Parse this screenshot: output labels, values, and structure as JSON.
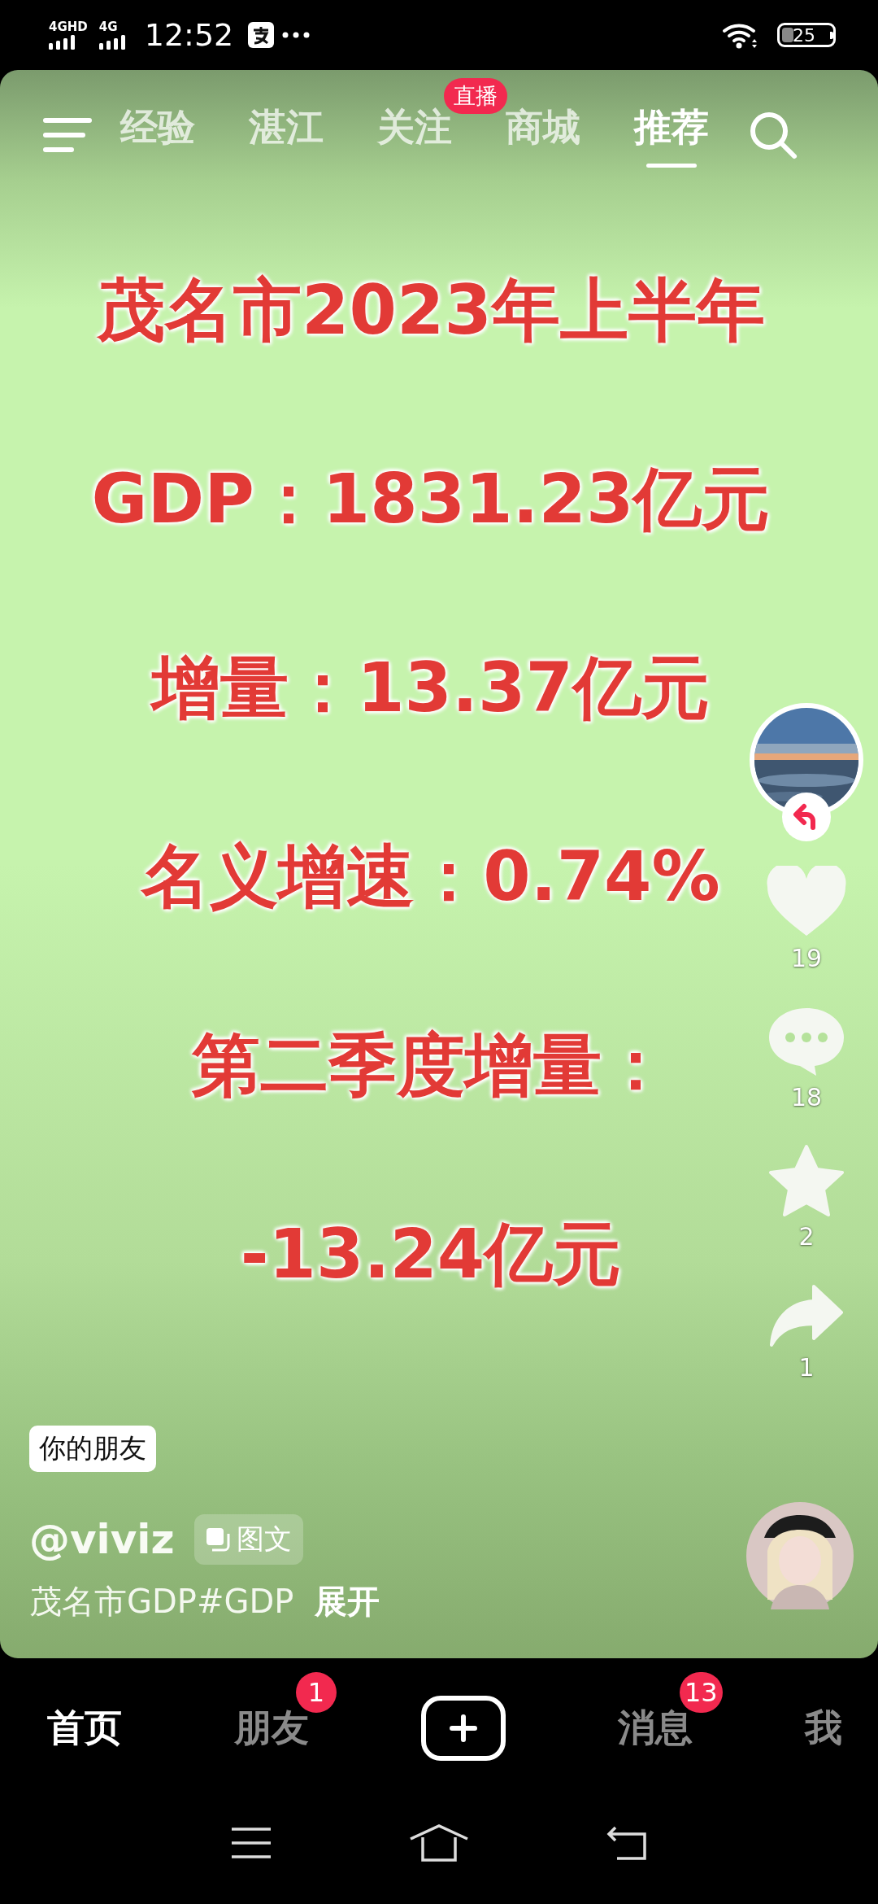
{
  "status_bar": {
    "networks": [
      "4GHD",
      "4G"
    ],
    "time": "12:52",
    "battery": "25"
  },
  "top_tabs": [
    {
      "label": "经验",
      "selected": false
    },
    {
      "label": "湛江",
      "selected": false
    },
    {
      "label": "关注",
      "selected": false,
      "badge": "直播"
    },
    {
      "label": "商城",
      "selected": false
    },
    {
      "label": "推荐",
      "selected": true
    }
  ],
  "poster_lines": [
    "茂名市2023年上半年",
    "GDP：1831.23亿元",
    "增量：13.37亿元",
    "名义增速：0.74%",
    "第二季度增量：",
    "-13.24亿元"
  ],
  "side_actions": [
    {
      "kind": "like",
      "count": "19"
    },
    {
      "kind": "comment",
      "count": "18"
    },
    {
      "kind": "favorite",
      "count": "2"
    },
    {
      "kind": "share",
      "count": "1"
    }
  ],
  "friend_tag": "你的朋友",
  "author": "@viviz",
  "post_type": "图文",
  "caption": "茂名市GDP#GDP",
  "expand": "展开",
  "bottom_nav": [
    {
      "kind": "tab",
      "label": "首页",
      "selected": true
    },
    {
      "kind": "tab",
      "label": "朋友",
      "selected": false,
      "badge": "1"
    },
    {
      "kind": "create"
    },
    {
      "kind": "tab",
      "label": "消息",
      "selected": false,
      "badge": "13"
    },
    {
      "kind": "tab",
      "label": "我",
      "selected": false
    }
  ]
}
